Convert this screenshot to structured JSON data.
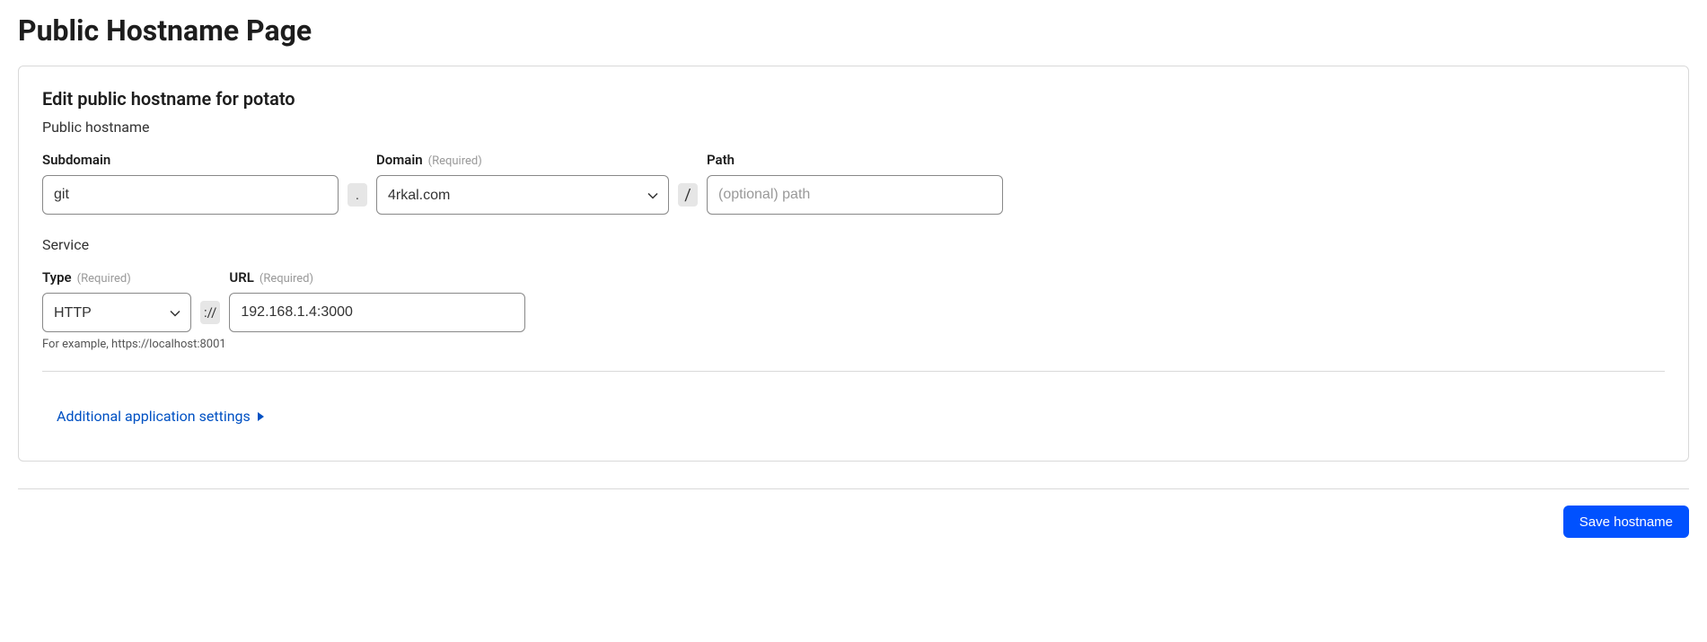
{
  "page": {
    "title": "Public Hostname Page"
  },
  "card": {
    "title": "Edit public hostname for potato",
    "section_hostname_label": "Public hostname",
    "section_service_label": "Service"
  },
  "labels": {
    "subdomain": "Subdomain",
    "domain": "Domain",
    "path": "Path",
    "type": "Type",
    "url": "URL",
    "required": "(Required)"
  },
  "separators": {
    "dot": ".",
    "slash": "/",
    "scheme": "://"
  },
  "inputs": {
    "subdomain_value": "git",
    "domain_value": "4rkal.com",
    "path_value": "",
    "path_placeholder": "(optional) path",
    "type_value": "HTTP",
    "url_value": "192.168.1.4:3000"
  },
  "helper": {
    "service_example": "For example, https://localhost:8001"
  },
  "expand": {
    "label": "Additional application settings"
  },
  "footer": {
    "save_label": "Save hostname"
  }
}
